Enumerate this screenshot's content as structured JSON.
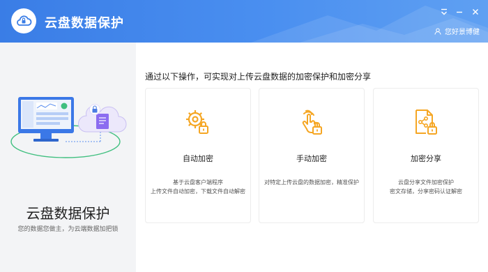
{
  "header": {
    "title": "云盘数据保护",
    "user_label": "您好景博健"
  },
  "left_panel": {
    "title": "云盘数据保护",
    "subtitle": "您的数据您做主，为云端数据加把锁"
  },
  "main": {
    "heading": "通过以下操作，可实现对上传云盘数据的加密保护和加密分享",
    "cards": [
      {
        "title": "自动加密",
        "icon": "gear-lock-icon",
        "desc": [
          "基于云盘客户端程序",
          "上传文件自动加密，下载文件自动解密"
        ]
      },
      {
        "title": "手动加密",
        "icon": "hand-lock-icon",
        "desc": [
          "对特定上传云盘的数据加密，精准保护"
        ]
      },
      {
        "title": "加密分享",
        "icon": "share-lock-icon",
        "desc": [
          "云盘分享文件加密保护",
          "密文存储，分享密码认证解密"
        ]
      }
    ]
  },
  "colors": {
    "header": "#3a7de6",
    "accent_orange": "#f5a623",
    "sidebar_bg": "#f3f4f6"
  }
}
